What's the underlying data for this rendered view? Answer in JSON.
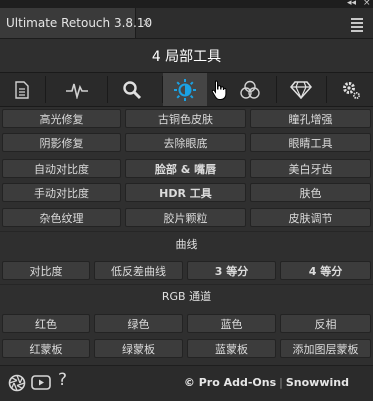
{
  "window": {
    "tab_title": "Ultimate Retouch 3.8.10",
    "close_glyph": "×",
    "collapse_glyph": "◂◂",
    "expand_glyph": "×"
  },
  "panel": {
    "title": "4 局部工具"
  },
  "toolbar": {
    "tools": [
      {
        "icon": "document-icon"
      },
      {
        "icon": "pulse-icon"
      },
      {
        "icon": "magnifier-icon"
      },
      {
        "icon": "brightness-icon",
        "active": true
      },
      {
        "icon": "overlap-circles-icon"
      },
      {
        "icon": "diamond-icon"
      },
      {
        "icon": "gear-icon"
      }
    ]
  },
  "local_tools": {
    "rows": [
      [
        "高光修复",
        "古铜色皮肤",
        "瞳孔增强"
      ],
      [
        "阴影修复",
        "去除眼底",
        "眼睛工具"
      ],
      [
        "自动对比度",
        "脸部 & 嘴唇",
        "美白牙齿"
      ],
      [
        "手动对比度",
        "HDR 工具",
        "肤色"
      ],
      [
        "杂色纹理",
        "胶片颗粒",
        "皮肤调节"
      ]
    ]
  },
  "curves": {
    "title": "曲线",
    "buttons": [
      "对比度",
      "低反差曲线",
      "3 等分",
      "4 等分"
    ]
  },
  "rgb": {
    "title": "RGB 通道",
    "row1": [
      "红色",
      "绿色",
      "蓝色",
      "反相"
    ],
    "row2": [
      "红蒙板",
      "绿蒙板",
      "蓝蒙板",
      "添加图层蒙板"
    ]
  },
  "footer": {
    "help": "?",
    "brand": "© Pro Add-Ons",
    "separator": "|",
    "author": "Snowwind"
  },
  "colors": {
    "accent": "#1ba1e2",
    "background": "#2f2f2f",
    "button": "#3c3c3c"
  }
}
